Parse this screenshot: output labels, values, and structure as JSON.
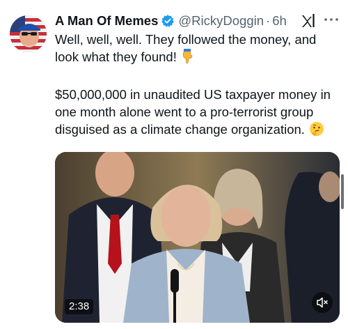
{
  "tweet": {
    "display_name": "A Man Of Memes",
    "handle": "@RickyDoggin",
    "separator": "·",
    "time": "6h",
    "text_lines": [
      "Well, well, well. They followed the money, and look what they found!",
      "$50,000,000 in unaudited US taxpayer money in one month alone went to a pro-terrorist group disguised as a climate change organization."
    ],
    "emojis": [
      "backhand-index-pointing-down",
      "thinking-face"
    ],
    "video": {
      "duration": "2:38",
      "muted": true
    }
  },
  "icons": {
    "verified": "verified-badge-icon",
    "grok": "grok-icon",
    "more": "more-icon",
    "mute": "mute-icon"
  },
  "colors": {
    "verified_blue": "#1d9bf0",
    "text": "#0f1419",
    "secondary": "#536471"
  }
}
